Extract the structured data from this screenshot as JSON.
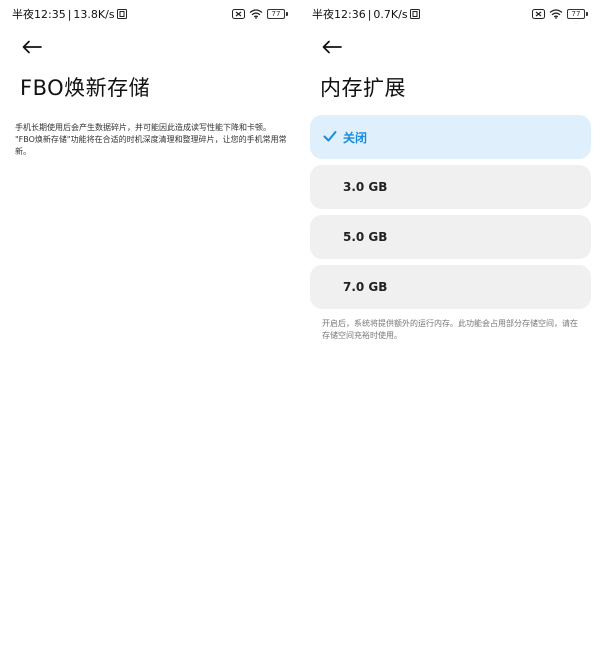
{
  "left_screen": {
    "status": {
      "time": "半夜12:35",
      "separator": "|",
      "speed": "13.8K/s",
      "battery": "77"
    },
    "title": "FBO焕新存储",
    "description_lines": [
      "手机长期使用后会产生数据碎片，并可能因此造成读写性能下降和卡顿。",
      "\"FBO焕新存储\"功能将在合适的时机深度清理和整理碎片，让您的手机常用常新。"
    ]
  },
  "right_screen": {
    "status": {
      "time": "半夜12:36",
      "separator": "|",
      "speed": "0.7K/s",
      "battery": "77"
    },
    "title": "内存扩展",
    "options": [
      {
        "label": "关闭",
        "selected": true
      },
      {
        "label": "3.0 GB",
        "selected": false
      },
      {
        "label": "5.0 GB",
        "selected": false
      },
      {
        "label": "7.0 GB",
        "selected": false
      }
    ],
    "note": "开启后，系统将提供额外的运行内存。此功能会占用部分存储空间，请在存储空间充裕时使用。"
  },
  "colors": {
    "accent": "#1a8bdc",
    "selected_bg": "#dff0fc",
    "option_bg": "#f0f0f0"
  },
  "icons": [
    "back-arrow-icon",
    "check-icon",
    "sim-icon",
    "wifi-icon",
    "battery-icon",
    "data-icon"
  ]
}
